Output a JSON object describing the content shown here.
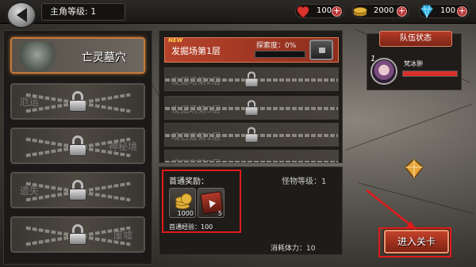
{
  "player": {
    "level_label": "主角等级:",
    "level": "1"
  },
  "resources": [
    {
      "icon": "heart-icon",
      "value": "100",
      "color": "#d8332e"
    },
    {
      "icon": "gold-coin-icon",
      "value": "2000",
      "color": "#e4b33a"
    },
    {
      "icon": "diamond-icon",
      "value": "100",
      "color": "#35b6e8"
    }
  ],
  "zones": [
    {
      "name": "亡灵墓穴",
      "state": "unlocked"
    },
    {
      "name": "厄运",
      "state": "locked"
    },
    {
      "name": "神秘境",
      "state": "locked"
    },
    {
      "name": "遗失",
      "state": "locked"
    },
    {
      "name": "废墟",
      "state": "locked"
    }
  ],
  "stages": [
    {
      "name": "发掘场第1层",
      "state": "unlocked",
      "badge": "NEW"
    },
    {
      "name": "发掘场第2层",
      "state": "locked"
    },
    {
      "name": "发掘场第3层",
      "state": "locked"
    },
    {
      "name": "魂石窟第1层",
      "state": "locked"
    },
    {
      "name": "魂石窟第2层",
      "state": "locked"
    }
  ],
  "exploration": {
    "label": "探索度：0%",
    "percent": 0
  },
  "reward": {
    "title": "首通奖励：",
    "monster_level_label": "怪物等级：",
    "monster_level": "1",
    "items": [
      {
        "icon": "gold-coins-icon",
        "quantity": "1000"
      },
      {
        "icon": "exp-book-icon",
        "quantity": "5"
      }
    ],
    "exp_label": "首通经验：",
    "exp_value": "100",
    "stamina_label": "消耗体力：",
    "stamina_value": "10"
  },
  "team": {
    "header": "队伍状态",
    "hero_level": "1",
    "hero_name": "梵冰翀",
    "hp_percent": 100
  },
  "actions": {
    "enter_label": "进入关卡"
  },
  "colors": {
    "accent": "#b5432b",
    "highlight": "#e01b1b"
  }
}
